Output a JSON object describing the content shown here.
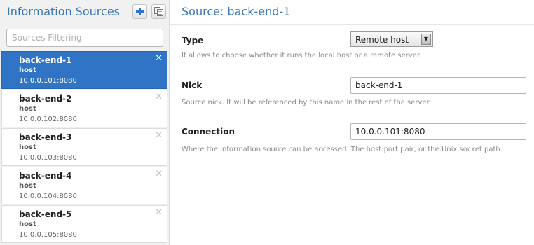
{
  "sidebar": {
    "title": "Information Sources",
    "add_icon": "plus-icon",
    "clone_icon": "clone-icon",
    "filter_placeholder": "Sources Filtering",
    "items": [
      {
        "nick": "back-end-1",
        "type": "host",
        "address": "10.0.0.101:8080",
        "selected": true
      },
      {
        "nick": "back-end-2",
        "type": "host",
        "address": "10.0.0.102:8080",
        "selected": false
      },
      {
        "nick": "back-end-3",
        "type": "host",
        "address": "10.0.0.103:8080",
        "selected": false
      },
      {
        "nick": "back-end-4",
        "type": "host",
        "address": "10.0.0.104:8080",
        "selected": false
      },
      {
        "nick": "back-end-5",
        "type": "host",
        "address": "10.0.0.105:8080",
        "selected": false
      }
    ],
    "remove_glyph": "✕"
  },
  "main": {
    "title": "Source: back-end-1",
    "type": {
      "label": "Type",
      "value": "Remote host",
      "help": "It allows to choose whether it runs the local host or a remote server."
    },
    "nick": {
      "label": "Nick",
      "value": "back-end-1",
      "help": "Source nick. It will be referenced by this name in the rest of the server."
    },
    "connection": {
      "label": "Connection",
      "value": "10.0.0.101:8080",
      "help": "Where the information source can be accessed. The host:port pair, or the Unix socket path."
    }
  },
  "colors": {
    "accent": "#3a77b8",
    "selected": "#2f74c5"
  }
}
